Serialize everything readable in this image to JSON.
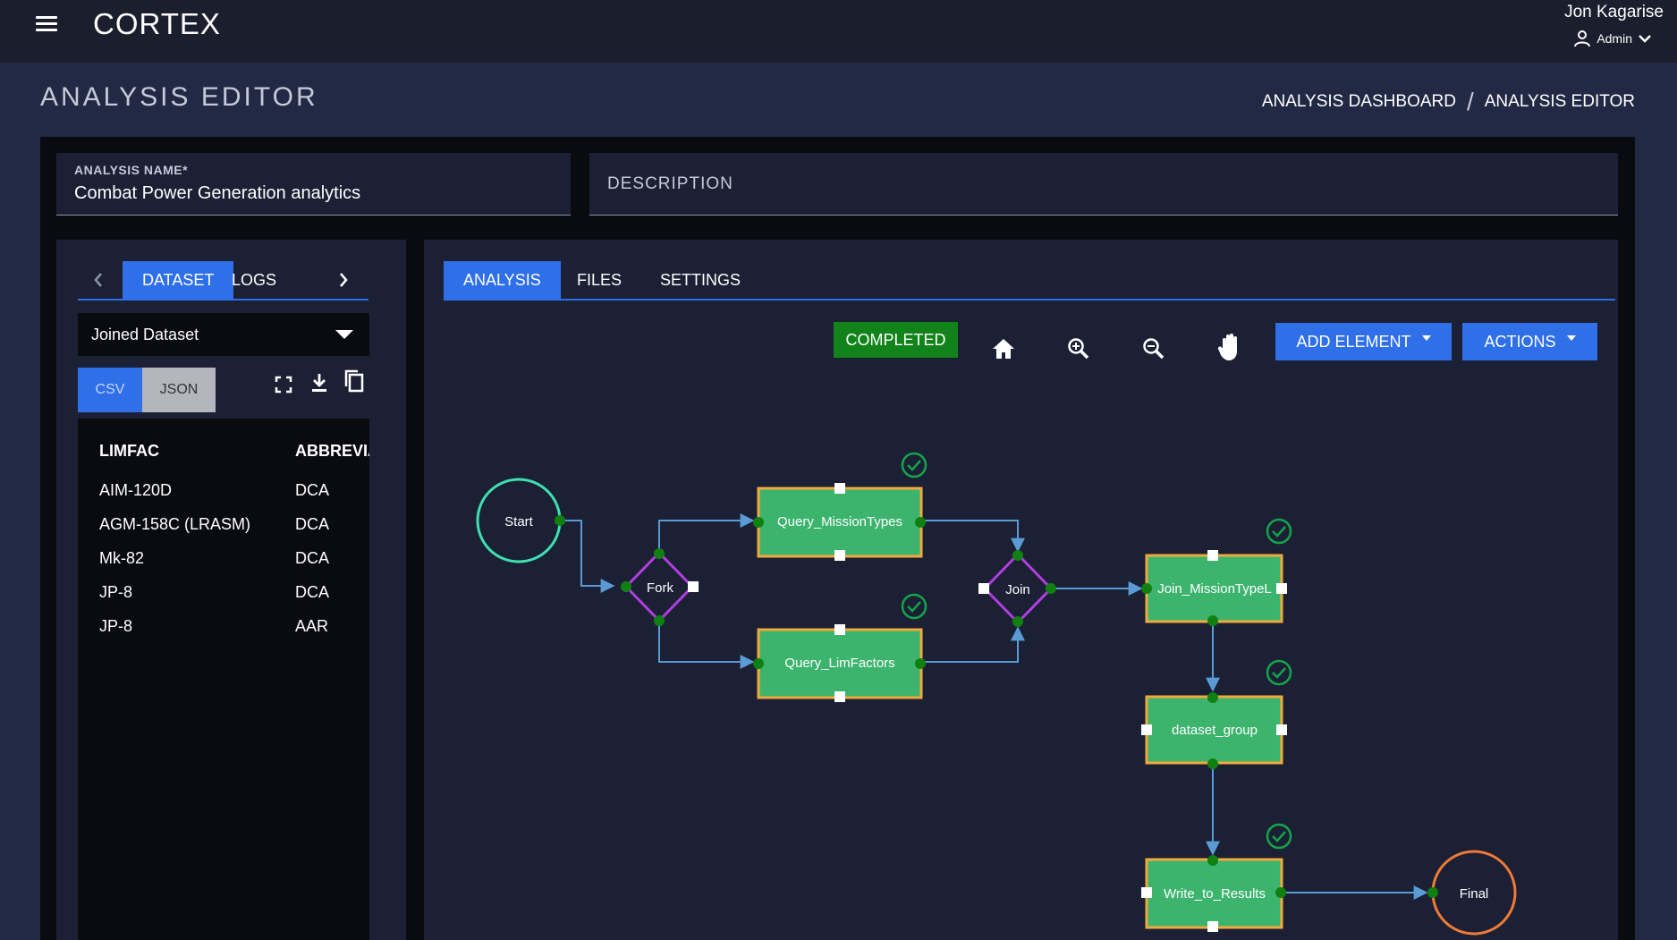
{
  "app": {
    "brand": "CORTEX"
  },
  "user": {
    "name": "Jon Kagarise",
    "role": "Admin"
  },
  "page": {
    "title": "ANALYSIS EDITOR"
  },
  "breadcrumb": {
    "items": [
      "ANALYSIS DASHBOARD",
      "ANALYSIS EDITOR"
    ],
    "separator": "/"
  },
  "form": {
    "name_label": "ANALYSIS NAME*",
    "name_value": "Combat Power Generation analytics",
    "description_label": "DESCRIPTION"
  },
  "left_panel": {
    "tabs": [
      "DATASET",
      "LOGS"
    ],
    "active_tab": "DATASET",
    "dataset_select": "Joined Dataset",
    "formats": [
      "CSV",
      "JSON"
    ],
    "active_format": "CSV",
    "icons": [
      "fullscreen-icon",
      "download-icon",
      "copy-icon"
    ],
    "table": {
      "columns": [
        "LIMFAC",
        "ABBREVIA"
      ],
      "rows": [
        [
          "AIM-120D",
          "DCA"
        ],
        [
          "AGM-158C (LRASM)",
          "DCA"
        ],
        [
          "Mk-82",
          "DCA"
        ],
        [
          "JP-8",
          "DCA"
        ],
        [
          "JP-8",
          "AAR"
        ]
      ]
    }
  },
  "right_panel": {
    "tabs": [
      "ANALYSIS",
      "FILES",
      "SETTINGS"
    ],
    "active_tab": "ANALYSIS",
    "status": "COMPLETED",
    "status_color": "#11831a",
    "tools": [
      "home-icon",
      "zoom-in-icon",
      "zoom-out-icon",
      "pan-hand-icon"
    ],
    "add_element_label": "ADD ELEMENT",
    "actions_label": "ACTIONS"
  },
  "workflow": {
    "nodes": [
      {
        "id": "start",
        "label": "Start",
        "type": "start-circle"
      },
      {
        "id": "fork",
        "label": "Fork",
        "type": "diamond"
      },
      {
        "id": "q_mission",
        "label": "Query_MissionTypes",
        "type": "task",
        "completed": true
      },
      {
        "id": "q_limf",
        "label": "Query_LimFactors",
        "type": "task",
        "completed": true
      },
      {
        "id": "join",
        "label": "Join",
        "type": "diamond"
      },
      {
        "id": "join_mission",
        "label": "Join_MissionTypeL",
        "type": "task",
        "completed": true
      },
      {
        "id": "dataset_group",
        "label": "dataset_group",
        "type": "task",
        "completed": true
      },
      {
        "id": "write",
        "label": "Write_to_Results",
        "type": "task",
        "completed": true
      },
      {
        "id": "final",
        "label": "Final",
        "type": "end-circle"
      }
    ],
    "colors": {
      "task_fill": "#3cb46e",
      "task_border": "#f2a93b",
      "diamond_border": "#b23ee0",
      "start_border": "#3ee0b0",
      "end_border": "#f07a36",
      "edge": "#5b9bd5",
      "port": "#108010",
      "check": "#16a34a"
    }
  }
}
